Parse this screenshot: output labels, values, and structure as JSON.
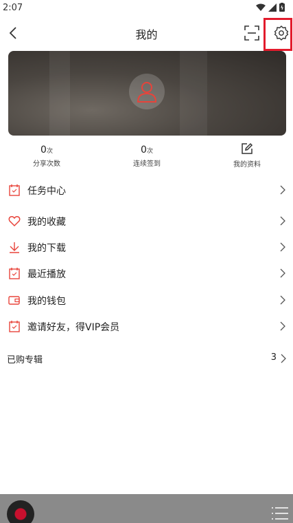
{
  "status": {
    "time": "2:07"
  },
  "header": {
    "title": "我的"
  },
  "stats": [
    {
      "value": "0",
      "unit": "次",
      "label": "分享次数"
    },
    {
      "value": "0",
      "unit": "次",
      "label": "连续签到"
    },
    {
      "label": "我的资料"
    }
  ],
  "menu": [
    {
      "label": "任务中心",
      "icon": "calendar-icon"
    },
    {
      "label": "我的收藏",
      "icon": "heart-icon"
    },
    {
      "label": "我的下载",
      "icon": "download-icon"
    },
    {
      "label": "最近播放",
      "icon": "calendar-icon"
    },
    {
      "label": "我的钱包",
      "icon": "wallet-icon"
    },
    {
      "label": "邀请好友，得VIP会员",
      "icon": "calendar-icon"
    }
  ],
  "albums": {
    "label": "已购专辑",
    "count": "3"
  },
  "colors": {
    "accent": "#e8433a",
    "highlight": "#e21b2c"
  }
}
